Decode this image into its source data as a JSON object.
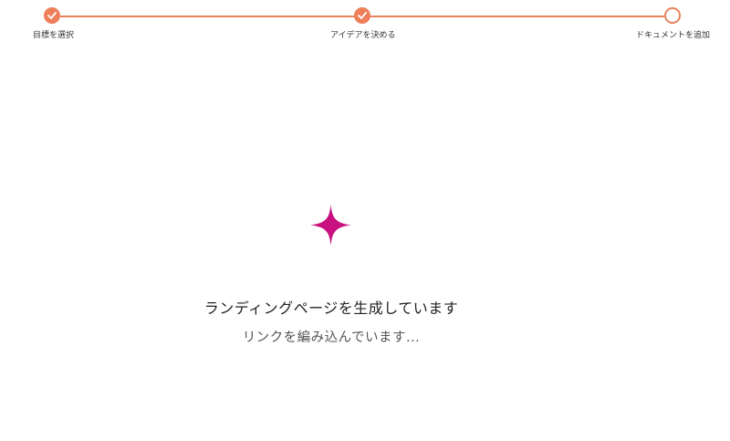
{
  "stepper": {
    "steps": [
      {
        "label": "目標を選択",
        "status": "done"
      },
      {
        "label": "アイデアを決める",
        "status": "done"
      },
      {
        "label": "ドキュメントを追加",
        "status": "pending"
      }
    ]
  },
  "main": {
    "title": "ランディングページを生成しています",
    "subtitle": "リンクを編み込んでいます..."
  },
  "colors": {
    "accent": "#ee7f5a",
    "sparkle": "#c8107e"
  },
  "icons": {
    "done": "checkmark-icon",
    "loading": "sparkle-icon"
  }
}
